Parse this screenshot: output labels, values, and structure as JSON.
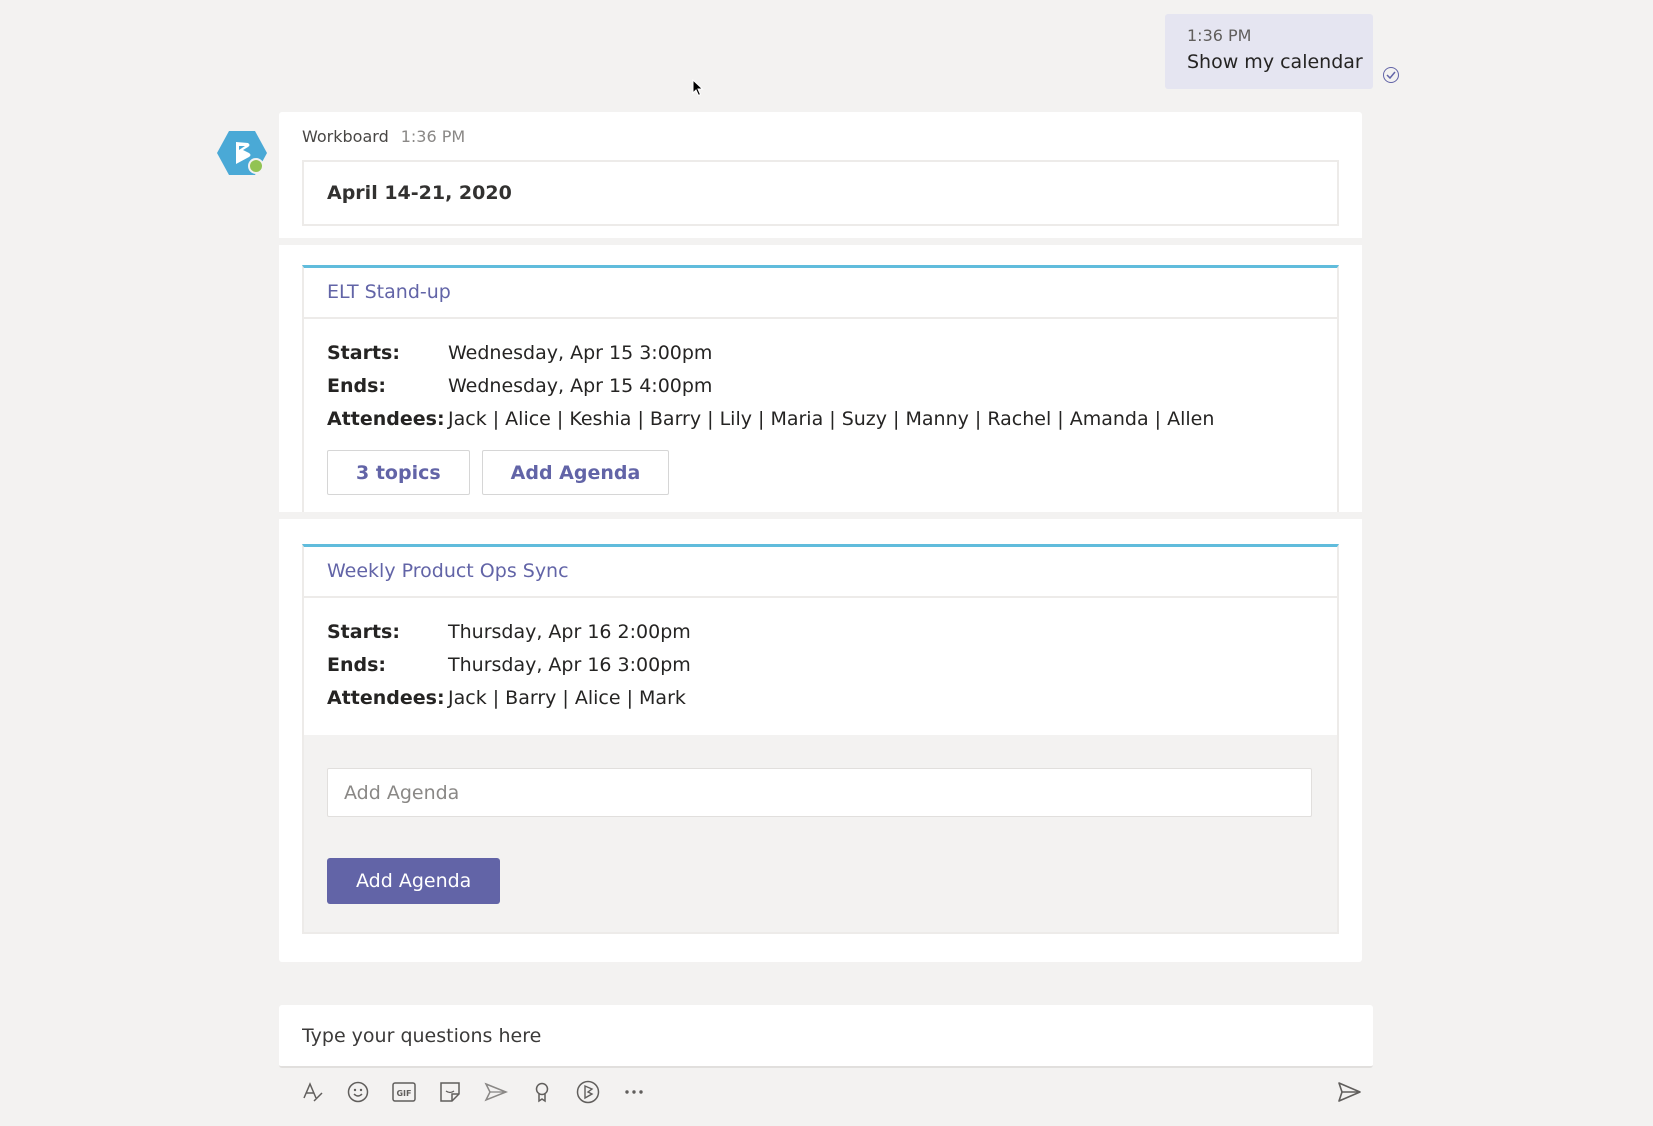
{
  "user_message": {
    "time": "1:36 PM",
    "text": "Show my calendar"
  },
  "bot_message": {
    "sender": "Workboard",
    "time": "1:36 PM",
    "date_range": "April 14-21, 2020",
    "events": [
      {
        "title": "ELT Stand-up",
        "starts_label": "Starts:",
        "starts": "Wednesday, Apr 15 3:00pm",
        "ends_label": "Ends:",
        "ends": "Wednesday, Apr 15 4:00pm",
        "attendees_label": "Attendees:",
        "attendees": "Jack | Alice | Keshia | Barry | Lily | Maria | Suzy | Manny | Rachel | Amanda | Allen",
        "topics_button": "3 topics",
        "add_agenda_button": "Add Agenda"
      },
      {
        "title": "Weekly Product Ops Sync",
        "starts_label": "Starts:",
        "starts": "Thursday, Apr 16 2:00pm",
        "ends_label": "Ends:",
        "ends": "Thursday, Apr 16 3:00pm",
        "attendees_label": "Attendees:",
        "attendees": "Jack | Barry | Alice | Mark",
        "agenda_placeholder": "Add Agenda",
        "add_agenda_button": "Add Agenda"
      }
    ]
  },
  "compose": {
    "placeholder": "Type your questions here"
  },
  "toolbar": {
    "icons": [
      "format-icon",
      "emoji-icon",
      "gif-icon",
      "sticker-icon",
      "meet-now-icon",
      "praise-icon",
      "workboard-app-icon",
      "more-options-icon"
    ]
  },
  "colors": {
    "accent": "#6264a7",
    "event_bar": "#60bcdc",
    "avatar": "#4aa9d6",
    "presence": "#92c353",
    "background": "#f3f2f1"
  }
}
